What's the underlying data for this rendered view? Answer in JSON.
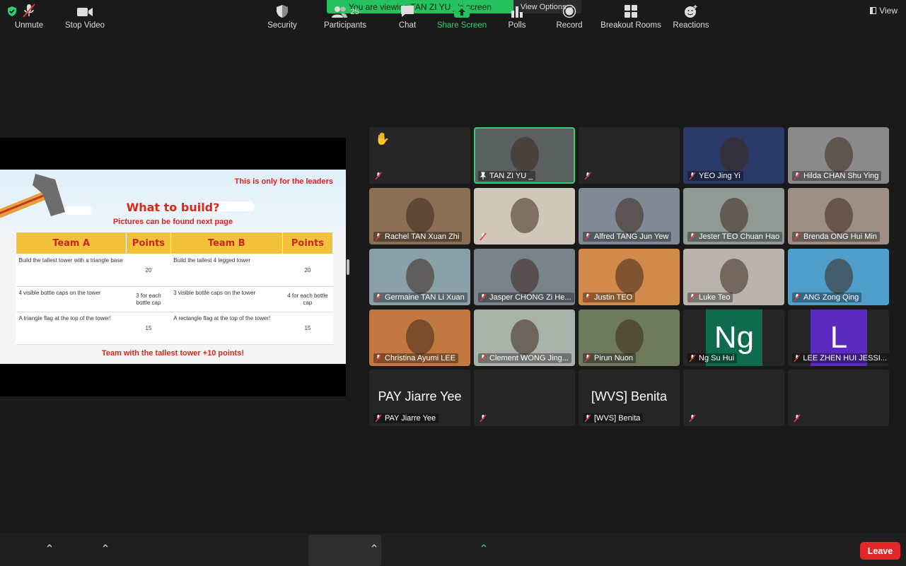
{
  "banner": {
    "text": "You are viewing TAN ZI YU _'s screen",
    "view_options": "View Options"
  },
  "top_right": {
    "view_label": "View"
  },
  "slide": {
    "note": "This is only for the leaders",
    "title": "What to build?",
    "subtitle": "Pictures can be found next page",
    "headers": [
      "Team A",
      "Points",
      "Team B",
      "Points"
    ],
    "rows": [
      [
        "Build the tallest tower with a triangle base",
        "20",
        "Build the tallest 4 legged tower",
        "20"
      ],
      [
        "4 visible bottle caps on the tower",
        "3 for each bottle cap",
        "3 visible bottle caps on the tower",
        "4 for each bottle cap"
      ],
      [
        "A triangle flag at the top of the tower!",
        "15",
        "A rectangle flag at the top of the tower!",
        "15"
      ]
    ],
    "footer": "Team with the tallest tower +10 points!"
  },
  "participants": [
    {
      "name": "",
      "hand": "✋"
    },
    {
      "name": "TAN ZI YU _",
      "pinned": true
    },
    {
      "name": ""
    },
    {
      "name": "YEO Jing Yi"
    },
    {
      "name": "Hilda CHAN Shu Ying"
    },
    {
      "name": "Rachel TAN Xuan Zhi"
    },
    {
      "name": ""
    },
    {
      "name": "Alfred TANG Jun Yew"
    },
    {
      "name": "Jester TEO Chuan Hao"
    },
    {
      "name": "Brenda ONG Hui Min"
    },
    {
      "name": "Germaine TAN Li Xuan"
    },
    {
      "name": "Jasper CHONG Zi He..."
    },
    {
      "name": "Justin TEO"
    },
    {
      "name": "Luke Teo"
    },
    {
      "name": "ANG Zong Qing"
    },
    {
      "name": "Christina Ayumi LEE"
    },
    {
      "name": "Clement WONG Jing..."
    },
    {
      "name": "Pirun Nuon"
    },
    {
      "name": "Ng Su Hui",
      "avatar_text": "Ng"
    },
    {
      "name": "LEE ZHEN HUI JESSI...",
      "avatar_text": "L"
    },
    {
      "name": "PAY Jiarre Yee",
      "big": "PAY Jiarre Yee"
    },
    {
      "name": ""
    },
    {
      "name": "[WVS] Benita",
      "big": "[WVS] Benita"
    },
    {
      "name": ""
    },
    {
      "name": ""
    }
  ],
  "toolbar": {
    "unmute": "Unmute",
    "stop_video": "Stop Video",
    "security": "Security",
    "participants": "Participants",
    "participants_count": "25",
    "chat": "Chat",
    "share_screen": "Share Screen",
    "polls": "Polls",
    "record": "Record",
    "breakout_rooms": "Breakout Rooms",
    "reactions": "Reactions",
    "leave": "Leave"
  },
  "colors": {
    "accent_green": "#24c15e",
    "leave_red": "#e02828",
    "slide_red": "#d42a1a",
    "header_yellow": "#f2c13b"
  }
}
